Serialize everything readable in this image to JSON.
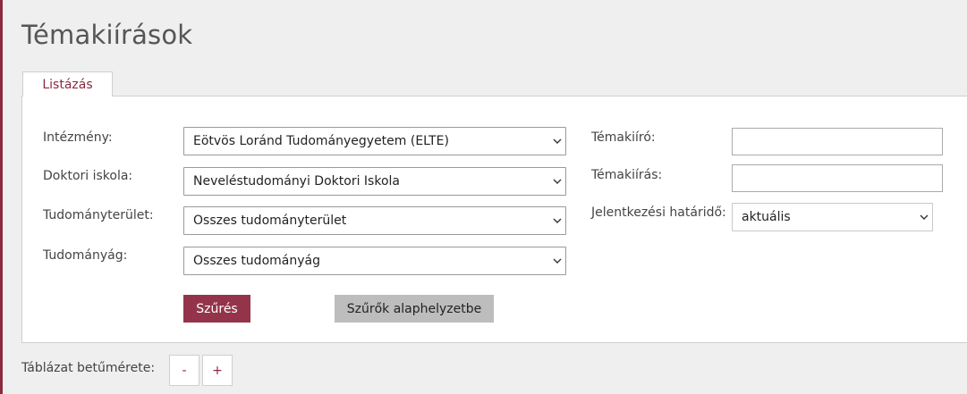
{
  "page": {
    "title": "Témakiírások"
  },
  "tabs": [
    {
      "label": "Listázás",
      "active": true
    }
  ],
  "filters": {
    "intezmeny": {
      "label": "Intézmény:",
      "value": "Eötvös Loránd Tudományegyetem (ELTE)"
    },
    "doktori_iskola": {
      "label": "Doktori iskola:",
      "value": "Neveléstudományi Doktori Iskola"
    },
    "tudomanyterulet": {
      "label": "Tudományterület:",
      "value": "Összes tudományterület"
    },
    "tudomanyag": {
      "label": "Tudományág:",
      "value": "Összes tudományág"
    },
    "temakiiro": {
      "label": "Témakiíró:",
      "value": ""
    },
    "temakiiras": {
      "label": "Témakiírás:",
      "value": ""
    },
    "jelentkezesi_hatarido": {
      "label": "Jelentkezési határidő:",
      "value": "aktuális"
    }
  },
  "actions": {
    "filter_label": "Szűrés",
    "reset_label": "Szűrők alaphelyzetbe"
  },
  "table_font": {
    "label": "Táblázat betűmérete:",
    "decrease": "-",
    "increase": "+"
  },
  "colors": {
    "accent": "#93344a",
    "secondary_button": "#bdbdbd",
    "background": "#efefef"
  },
  "icons": {
    "select_arrow": "chevron-down-icon"
  }
}
